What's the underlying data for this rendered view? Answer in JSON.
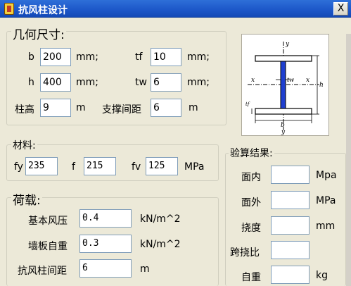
{
  "window": {
    "title": "抗风柱设计",
    "close_glyph": "X"
  },
  "geometry": {
    "legend": "几何尺寸:",
    "b": {
      "label": "b",
      "value": "200",
      "unit": "mm;"
    },
    "h": {
      "label": "h",
      "value": "400",
      "unit": "mm;"
    },
    "tf": {
      "label": "tf",
      "value": "10",
      "unit": "mm;"
    },
    "tw": {
      "label": "tw",
      "value": "6",
      "unit": "mm;"
    },
    "column_height": {
      "label": "柱高",
      "value": "9",
      "unit": "m"
    },
    "brace_spacing": {
      "label": "支撑间距",
      "value": "6",
      "unit": "m"
    }
  },
  "diagram": {
    "labels": {
      "top": "y",
      "bottom": "y",
      "left_axis": "x",
      "right_axis": "x",
      "web": "tw",
      "height": "h",
      "flange": "tf",
      "width": "b"
    }
  },
  "material": {
    "legend": "材料:",
    "fy": {
      "label": "fy",
      "value": "235"
    },
    "f": {
      "label": "f",
      "value": "215"
    },
    "fv": {
      "label": "fv",
      "value": "125"
    },
    "unit": "MPa"
  },
  "loads": {
    "legend": "荷载:",
    "wind_pressure": {
      "label": "基本风压",
      "value": "0.4",
      "unit": "kN/m^2"
    },
    "wall_weight": {
      "label": "墙板自重",
      "value": "0.3",
      "unit": "kN/m^2"
    },
    "column_spacing": {
      "label": "抗风柱间距",
      "value": "6",
      "unit": "m"
    }
  },
  "results": {
    "legend": "验算结果:",
    "in_plane": {
      "label": "面内",
      "value": "",
      "unit": "Mpa"
    },
    "out_plane": {
      "label": "面外",
      "value": "",
      "unit": "MPa"
    },
    "deflection": {
      "label": "挠度",
      "value": "",
      "unit": "mm"
    },
    "span_ratio": {
      "label": "跨挠比",
      "value": "",
      "unit": ""
    },
    "self_weight": {
      "label": "自重",
      "value": "",
      "unit": "kg"
    }
  }
}
